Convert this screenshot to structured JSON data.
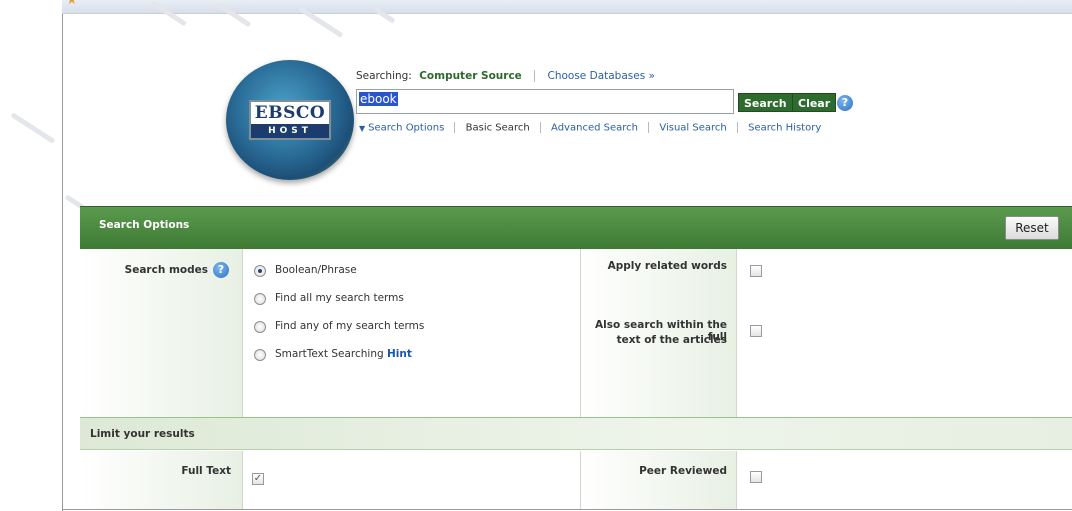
{
  "logo": {
    "brand": "EBSCO",
    "sub": "HOST"
  },
  "search": {
    "searching_label": "Searching:",
    "database": "Computer Source",
    "choose_databases": "Choose Databases »",
    "query": "ebook",
    "search_button": "Search",
    "clear_button": "Clear",
    "help": "?"
  },
  "search_links": {
    "search_options": "Search Options",
    "basic_search": "Basic Search",
    "advanced_search": "Advanced Search",
    "visual_search": "Visual Search",
    "search_history": "Search History"
  },
  "options_panel": {
    "title": "Search Options",
    "reset": "Reset",
    "search_modes_label": "Search modes",
    "modes": [
      {
        "label": "Boolean/Phrase",
        "selected": true
      },
      {
        "label": "Find all my search terms",
        "selected": false
      },
      {
        "label": "Find any of my search terms",
        "selected": false
      },
      {
        "label": "SmartText Searching",
        "selected": false
      }
    ],
    "hint": "Hint",
    "apply_related_words": "Apply related words",
    "also_search_fulltext_line1": "Also search within the full",
    "also_search_fulltext_line2": "text of the articles"
  },
  "limits": {
    "title": "Limit your results",
    "full_text": "Full Text",
    "full_text_checked": true,
    "peer_reviewed": "Peer Reviewed",
    "peer_reviewed_checked": false
  },
  "colors": {
    "green_header": "#3e7a34",
    "button_green": "#2e6b2e",
    "link_blue": "#2a5fa5"
  }
}
